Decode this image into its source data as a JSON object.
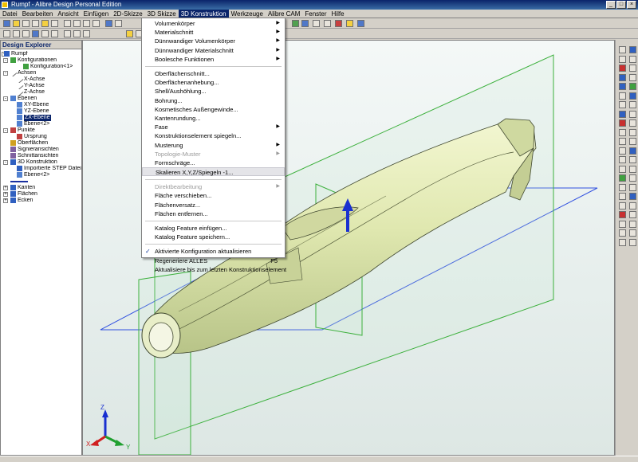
{
  "window": {
    "title": "Rumpf - Alibre Design Personal Edition"
  },
  "menubar": {
    "items": [
      "Datei",
      "Bearbeiten",
      "Ansicht",
      "Einfügen",
      "2D-Skizze",
      "3D Skizze",
      "3D Konstruktion",
      "Werkzeuge",
      "Alibre CAM",
      "Fenster",
      "Hilfe"
    ],
    "active_index": 6
  },
  "sidebar": {
    "title": "Design Explorer",
    "tree": [
      {
        "label": "Rumpf",
        "level": 0,
        "exp": "-",
        "icon": "part-icon"
      },
      {
        "label": "Konfigurationen",
        "level": 1,
        "exp": "-",
        "icon": "config-icon"
      },
      {
        "label": "Konfiguration<1>",
        "level": 3,
        "exp": "",
        "icon": "config-icon"
      },
      {
        "label": "Achsen",
        "level": 1,
        "exp": "-",
        "icon": "axis-icon"
      },
      {
        "label": "X-Achse",
        "level": 2,
        "exp": "",
        "icon": "axis-icon"
      },
      {
        "label": "Y-Achse",
        "level": 2,
        "exp": "",
        "icon": "axis-icon"
      },
      {
        "label": "Z-Achse",
        "level": 2,
        "exp": "",
        "icon": "axis-icon"
      },
      {
        "label": "Ebenen",
        "level": 1,
        "exp": "-",
        "icon": "plane-icon"
      },
      {
        "label": "XY-Ebene",
        "level": 2,
        "exp": "",
        "icon": "plane-icon"
      },
      {
        "label": "YZ-Ebene",
        "level": 2,
        "exp": "",
        "icon": "plane-icon"
      },
      {
        "label": "ZX-Ebene",
        "level": 2,
        "exp": "",
        "icon": "plane-icon",
        "selected": true
      },
      {
        "label": "Ebene<2>",
        "level": 2,
        "exp": "",
        "icon": "plane-icon"
      },
      {
        "label": "Punkte",
        "level": 1,
        "exp": "-",
        "icon": "point-icon"
      },
      {
        "label": "Ursprung",
        "level": 2,
        "exp": "",
        "icon": "point-icon"
      },
      {
        "label": "Oberflächen",
        "level": 1,
        "exp": "",
        "icon": "surface-icon"
      },
      {
        "label": "Signieransichten",
        "level": 1,
        "exp": "",
        "icon": "view-icon"
      },
      {
        "label": "Schnittansichten",
        "level": 1,
        "exp": "",
        "icon": "view-icon"
      },
      {
        "label": "3D Konstruktion",
        "level": 1,
        "exp": "-",
        "icon": "feature-icon"
      },
      {
        "label": "Importierte STEP Datei",
        "level": 2,
        "exp": "",
        "icon": "step-icon"
      },
      {
        "label": "Ebene<2>",
        "level": 2,
        "exp": "",
        "icon": "plane-icon"
      },
      {
        "label": "",
        "level": 1,
        "exp": "",
        "icon": "end-marker-icon"
      },
      {
        "label": "Kanten",
        "level": 1,
        "exp": "+",
        "icon": "edge-icon"
      },
      {
        "label": "Flächen",
        "level": 1,
        "exp": "+",
        "icon": "face-icon"
      },
      {
        "label": "Ecken",
        "level": 1,
        "exp": "+",
        "icon": "vertex-icon"
      }
    ]
  },
  "dropdown": {
    "items": [
      {
        "label": "Volumenkörper",
        "submenu": true
      },
      {
        "label": "Materialschnitt",
        "submenu": true
      },
      {
        "label": "Dünnwandiger Volumenkörper",
        "submenu": true
      },
      {
        "label": "Dünnwandiger Materialschnitt",
        "submenu": true
      },
      {
        "label": "Boolesche Funktionen",
        "submenu": true
      },
      {
        "sep": true
      },
      {
        "label": "Oberflächenschnitt..."
      },
      {
        "label": "Oberflächenanhebung..."
      },
      {
        "label": "Shell/Aushöhlung..."
      },
      {
        "label": "Bohrung..."
      },
      {
        "label": "Kosmetisches Außengewinde..."
      },
      {
        "label": "Kantenrundung..."
      },
      {
        "label": "Fase",
        "submenu": true
      },
      {
        "label": "Konstruktionselement spiegeln..."
      },
      {
        "label": "Musterung",
        "submenu": true
      },
      {
        "label": "Topologie-Muster",
        "submenu": true,
        "disabled": true
      },
      {
        "label": "Formschräge..."
      },
      {
        "label": "Skalieren X,Y,Z/Spiegeln -1...",
        "highlighted": true
      },
      {
        "sep": true
      },
      {
        "label": "Direktbearbeitung",
        "submenu": true,
        "disabled": true
      },
      {
        "label": "Fläche verschieben..."
      },
      {
        "label": "Flächenversatz..."
      },
      {
        "label": "Flächen entfernen..."
      },
      {
        "sep": true
      },
      {
        "label": "Katalog Feature einfügen..."
      },
      {
        "label": "Katalog Feature speichern..."
      },
      {
        "sep": true
      },
      {
        "label": "Aktivierte Konfiguration aktualisieren",
        "checked": true
      },
      {
        "label": "Regeneriere ALLES",
        "shortcut": "F5"
      },
      {
        "label": "Aktualisiere bis zum letzten Konstruktionselement"
      }
    ]
  },
  "colors": {
    "accent": "#0a246a",
    "planes": "#3cb03c",
    "plane_blue": "#3050e0",
    "fuselage": "#e4ecb4"
  },
  "triad": {
    "x": "X",
    "y": "Y",
    "z": "Z"
  }
}
